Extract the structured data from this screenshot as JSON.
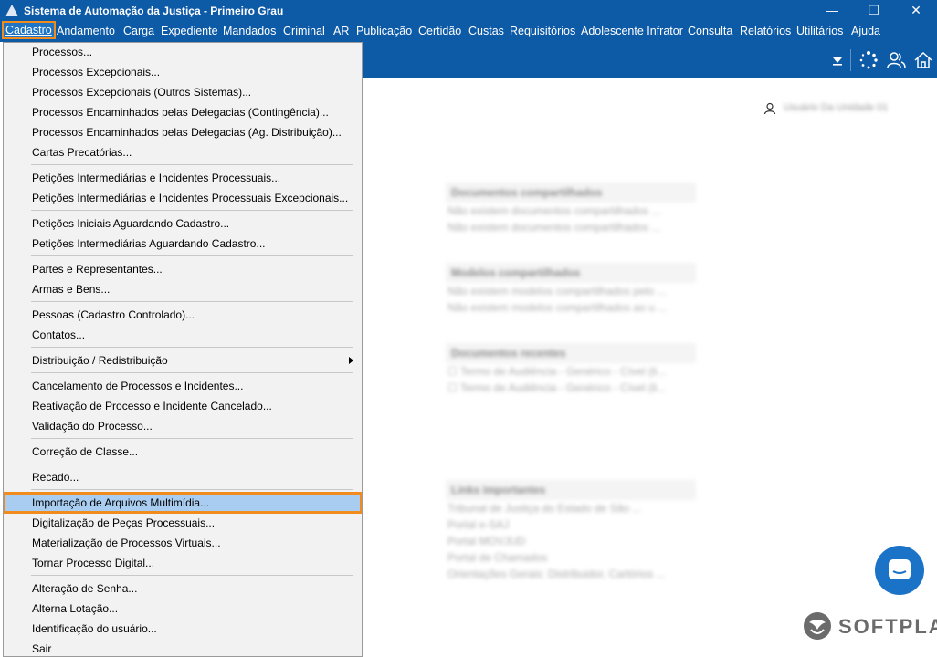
{
  "window": {
    "title": "Sistema de Automação da Justiça - Primeiro Grau",
    "minimize": "—",
    "maximize": "❐",
    "close": "✕"
  },
  "menubar": [
    "Cadastro",
    "Andamento",
    "Carga",
    "Expediente",
    "Mandados",
    "Criminal",
    "AR",
    "Publicação",
    "Certidão",
    "Custas",
    "Requisitórios",
    "Adolescente Infrator",
    "Consulta",
    "Relatórios",
    "Utilitários",
    "Ajuda"
  ],
  "menu_items": [
    "Processos...",
    "Processos Excepcionais...",
    "Processos Excepcionais (Outros Sistemas)...",
    "Processos Encaminhados pelas Delegacias (Contingência)...",
    "Processos Encaminhados pelas Delegacias (Ag. Distribuição)...",
    "Cartas Precatórias...",
    "Petições Intermediárias e Incidentes Processuais...",
    "Petições Intermediárias e Incidentes Processuais Excepcionais...",
    "Petições Iniciais Aguardando Cadastro...",
    "Petições Intermediárias Aguardando Cadastro...",
    "Partes e Representantes...",
    "Armas e Bens...",
    "Pessoas (Cadastro Controlado)...",
    "Contatos...",
    "Distribuição / Redistribuição",
    "Cancelamento de Processos e Incidentes...",
    "Reativação de Processo e Incidente Cancelado...",
    "Validação do Processo...",
    "Correção de Classe...",
    "Recado...",
    "Importação de Arquivos Multimídia...",
    "Digitalização de Peças Processuais...",
    "Materialização de Processos Virtuais...",
    "Tornar Processo Digital...",
    "Alteração de Senha...",
    "Alterna Lotação...",
    "Identificação do usuário...",
    "Sair"
  ],
  "content": {
    "user_name": "Usuário Da Unidade 01",
    "panels": [
      {
        "title": "Documentos compartilhados",
        "lines": [
          "Não existem documentos compartilhados ...",
          "Não existem documentos compartilhados ..."
        ]
      },
      {
        "title": "Modelos compartilhados",
        "lines": [
          "Não existem modelos compartilhados pelo ...",
          "Não existem modelos compartilhados ao u ..."
        ]
      },
      {
        "title": "Documentos recentes",
        "lines": [
          "Termo de Audiência - Genérico - Cível (li...",
          "Termo de Audiência - Genérico - Cível (li..."
        ]
      },
      {
        "title": "Links importantes",
        "lines": [
          "Tribunal de Justiça do Estado de São ...",
          "Portal e-SAJ",
          "Portal MOVJUD",
          "Portal de Chamados",
          "Orientações Gerais: Distribuidor, Cartórios ..."
        ]
      }
    ]
  },
  "brand": "SOFTPLAN",
  "colors": {
    "titlebar": "#0d5aa7",
    "highlight": "#a8cdf0",
    "callout": "#f08c1e",
    "chat": "#1a73c7"
  }
}
